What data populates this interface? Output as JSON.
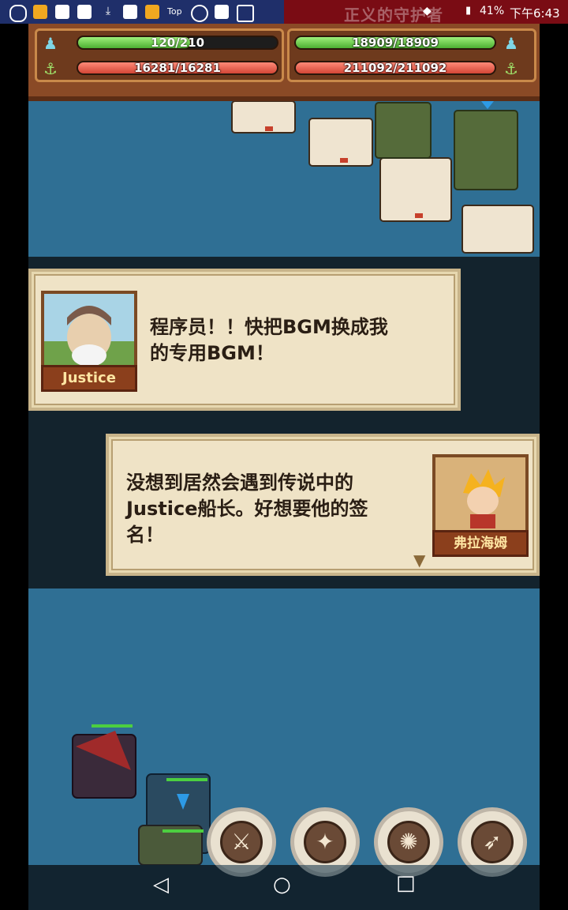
{
  "status_bar": {
    "time": "下午6:43",
    "battery": "41%",
    "top_label": "Top",
    "faded_title": "正义的守护者"
  },
  "hud": {
    "player": {
      "crew_text": "120/210",
      "crew_fraction": 0.57,
      "hull_text": "16281/16281",
      "hull_fraction": 1.0
    },
    "enemy": {
      "crew_text": "18909/18909",
      "crew_fraction": 1.0,
      "hull_text": "211092/211092",
      "hull_fraction": 1.0
    }
  },
  "dialogs": [
    {
      "speaker": "Justice",
      "text_line1": "程序员！！快把BGM换成我",
      "text_line2": "的专用BGM！"
    },
    {
      "speaker": "弗拉海姆",
      "text_line1": "没想到居然会遇到传说中的",
      "text_line2": "Justice船长。好想要他的签",
      "text_line3": "名！"
    }
  ],
  "skills": [
    {
      "icon": "sword-slash-icon"
    },
    {
      "icon": "burst-icon"
    },
    {
      "icon": "kraken-icon"
    },
    {
      "icon": "bird-icon"
    }
  ],
  "nav": {
    "back": "◁",
    "home": "○",
    "recents": "□"
  }
}
